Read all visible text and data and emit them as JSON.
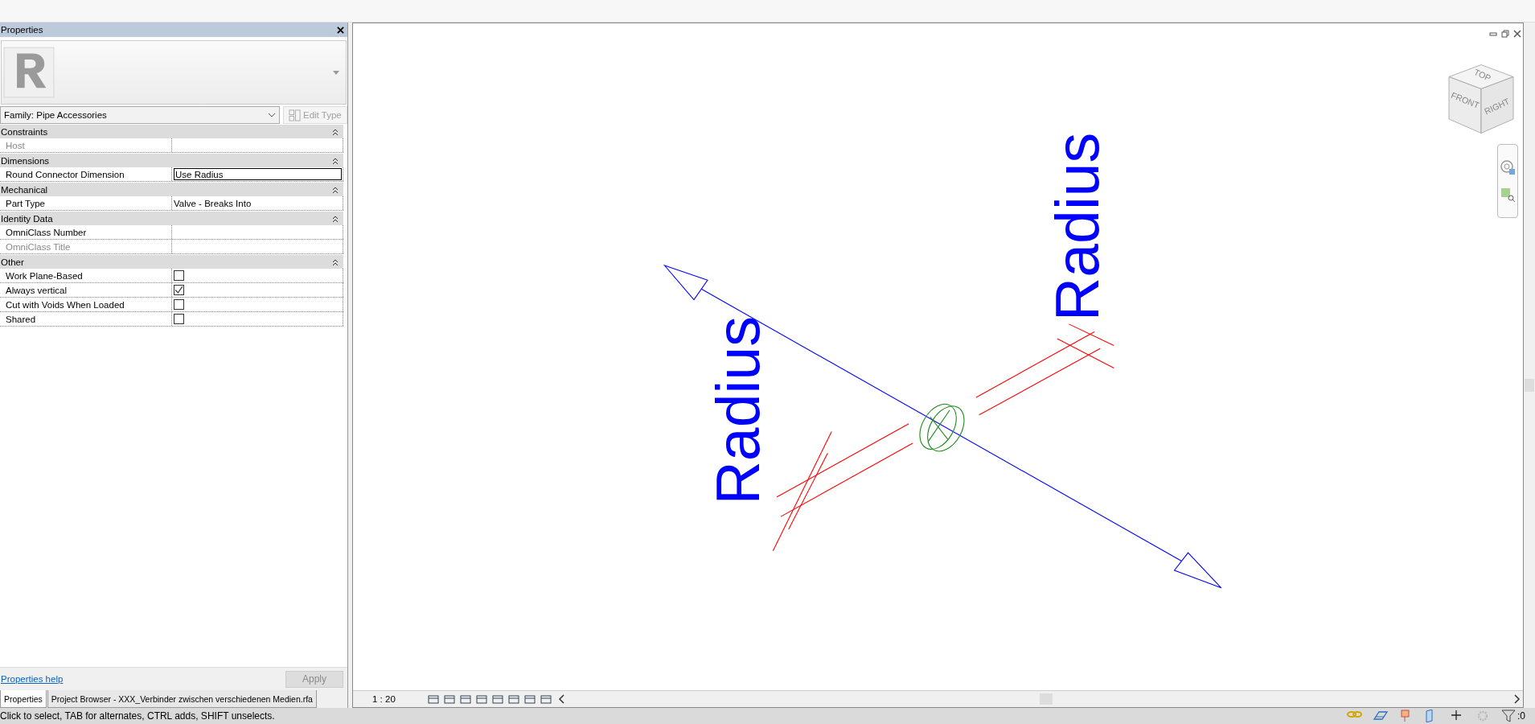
{
  "properties_panel": {
    "title": "Properties",
    "type_selector": {
      "label": "Family: Pipe Accessories"
    },
    "edit_type_button": {
      "label": "Edit Type",
      "disabled": true
    },
    "groups": [
      {
        "name": "Constraints",
        "expanded": true,
        "rows": [
          {
            "kind": "text",
            "label": "Host",
            "disabled": true
          }
        ]
      },
      {
        "name": "Dimensions",
        "expanded": true,
        "rows": [
          {
            "kind": "field",
            "label": "Round Connector Dimension",
            "value": "Use Radius",
            "disabled": false
          }
        ]
      },
      {
        "name": "Mechanical",
        "expanded": true,
        "rows": [
          {
            "kind": "text",
            "label": "Part Type",
            "value": "Valve - Breaks Into",
            "disabled": false
          }
        ]
      },
      {
        "name": "Identity Data",
        "expanded": true,
        "rows": [
          {
            "kind": "text",
            "label": "OmniClass Number",
            "disabled": false
          },
          {
            "kind": "text",
            "label": "OmniClass Title",
            "disabled": true
          }
        ]
      },
      {
        "name": "Other",
        "expanded": true,
        "rows": [
          {
            "kind": "checkbox",
            "label": "Work Plane-Based",
            "checked": false,
            "disabled": false
          },
          {
            "kind": "checkbox",
            "label": "Always vertical",
            "checked": true,
            "disabled": false
          },
          {
            "kind": "checkbox",
            "label": "Cut with Voids When Loaded",
            "checked": false,
            "disabled": false
          },
          {
            "kind": "checkbox",
            "label": "Shared",
            "checked": false,
            "disabled": false
          }
        ]
      }
    ],
    "help_link": "Properties help",
    "apply_button": {
      "label": "Apply",
      "disabled": true
    },
    "tabs": [
      {
        "label": "Properties",
        "selected": true
      },
      {
        "label": "Project Browser - XXX_Verbinder zwischen verschiedenen Medien.rfa",
        "selected": false
      }
    ]
  },
  "view": {
    "dimension_labels": [
      "Radius",
      "Radius"
    ],
    "view_cube": {
      "faces": [
        "TOP",
        "FRONT",
        "RIGHT"
      ]
    },
    "scale": "1 : 20"
  },
  "status_bar": {
    "message": "Click to select, TAB for alternates, CTRL adds, SHIFT unselects.",
    "filter_count": ":0"
  }
}
